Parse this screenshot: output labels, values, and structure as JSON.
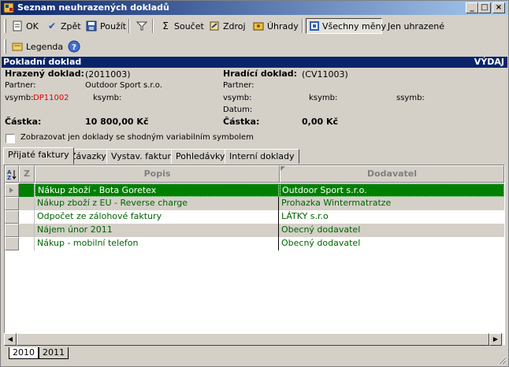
{
  "window": {
    "title": "Seznam neuhrazených dokladů"
  },
  "toolbar": {
    "ok": "OK",
    "back": "Zpět",
    "use": "Použít",
    "sum": "Součet",
    "source": "Zdroj",
    "payments": "Úhrady",
    "all_currencies": "Všechny měny",
    "only_paid": "Jen uhrazené",
    "legend": "Legenda"
  },
  "document": {
    "type": "Pokladní doklad",
    "direction": "VÝDAJ",
    "paid_doc_label": "Hrazený doklad:",
    "paid_doc_value": "(2011003)",
    "paying_doc_label": "Hradící doklad:",
    "paying_doc_value": "(CV11003)",
    "partner_label": "Partner:",
    "partner_value": "Outdoor Sport s.r.o.",
    "partner2_label": "Partner:",
    "vsymb_label": "vsymb:",
    "vsymb_value": "DP11002",
    "ksymb_label": "ksymb:",
    "vsymb2_label": "vsymb:",
    "ksymb2_label": "ksymb:",
    "ssymb_label": "ssymb:",
    "date_label": "Datum:",
    "amount_label": "Částka:",
    "amount_value": "10 800,00 Kč",
    "amount2_label": "Částka:",
    "amount2_value": "0,00 Kč"
  },
  "filter": {
    "same_vsymb": "Zobrazovat jen doklady se shodným variabilním symbolem"
  },
  "tabs": [
    "Přijaté faktury",
    "Závazky",
    "Vystav. faktury",
    "Pohledávky",
    "Interní doklady"
  ],
  "grid": {
    "columns": {
      "z": "Z",
      "popis": "Popis",
      "dodavatel": "Dodavatel"
    },
    "rows": [
      {
        "popis": "Nákup zboží - Bota Goretex",
        "dodavatel": "Outdoor Sport s.r.o."
      },
      {
        "popis": "Nákup zboží z EU - Reverse charge",
        "dodavatel": "Prohazka Wintermatratze"
      },
      {
        "popis": "Odpočet ze zálohové faktury",
        "dodavatel": "LÁTKY s.r.o"
      },
      {
        "popis": "Nájem únor 2011",
        "dodavatel": "Obecný dodavatel"
      },
      {
        "popis": "Nákup - mobilní telefon",
        "dodavatel": "Obecný dodavatel"
      }
    ]
  },
  "year_tabs": [
    "2010",
    "2011"
  ],
  "colors": {
    "title_bar": "#0a246a",
    "row_text": "#006400",
    "selected_row": "#008000",
    "vsymb": "#e00000"
  }
}
